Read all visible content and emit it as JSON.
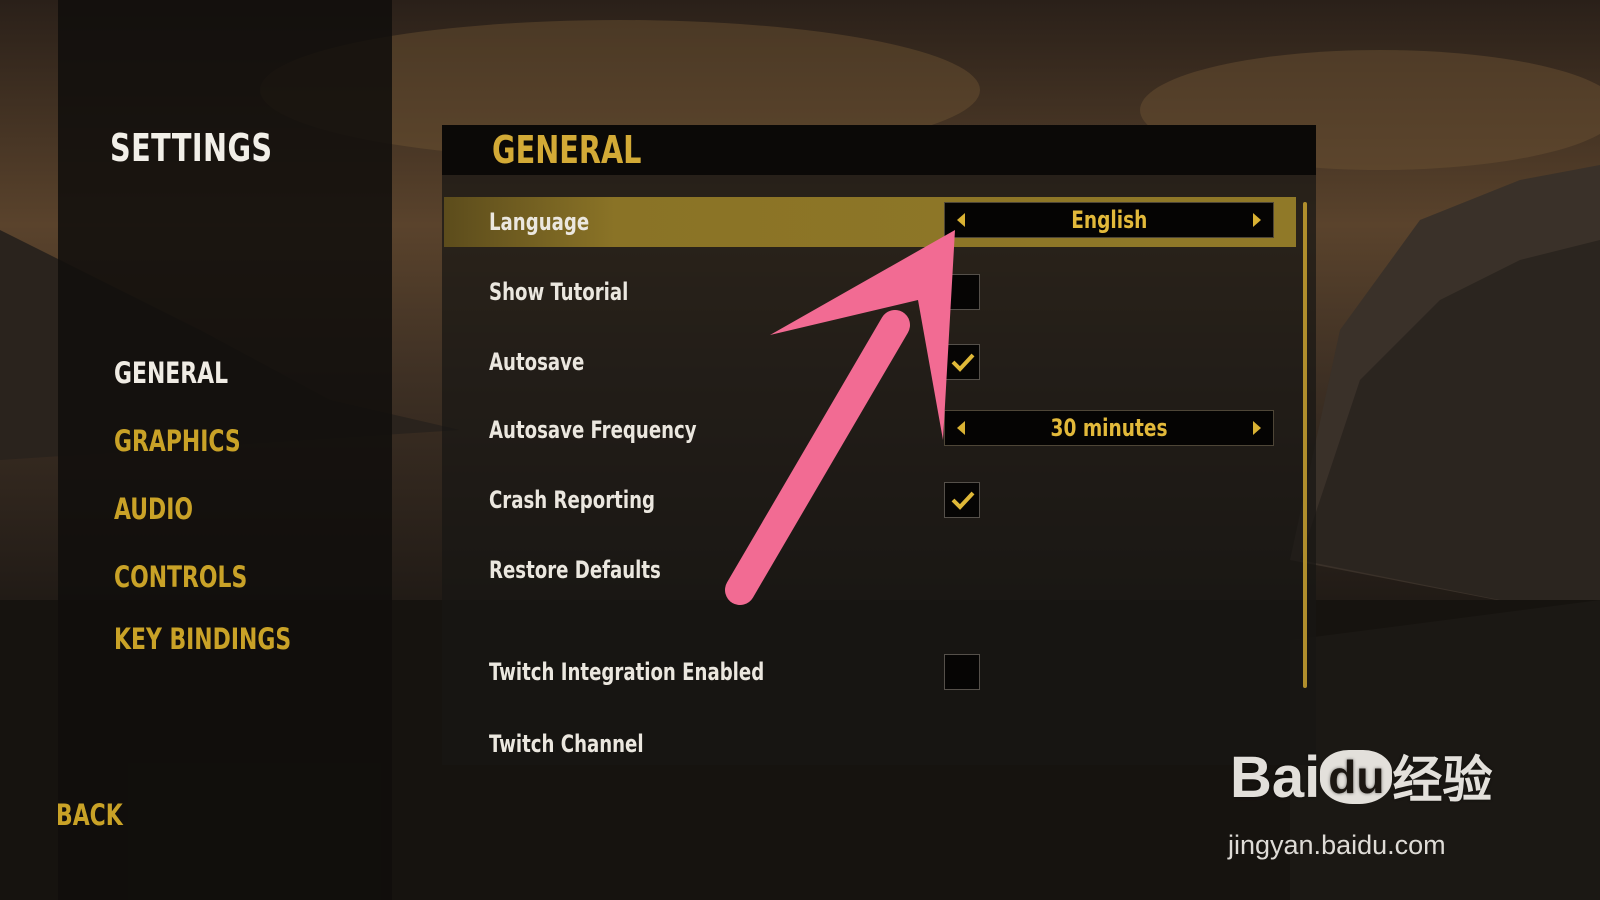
{
  "sidebar": {
    "title": "SETTINGS",
    "items": [
      {
        "label": "GENERAL",
        "active": true
      },
      {
        "label": "GRAPHICS",
        "active": false
      },
      {
        "label": "AUDIO",
        "active": false
      },
      {
        "label": "CONTROLS",
        "active": false
      },
      {
        "label": "KEY BINDINGS",
        "active": false
      }
    ],
    "back_label": "BACK"
  },
  "main": {
    "title": "GENERAL",
    "rows": {
      "language": {
        "label": "Language",
        "value": "English",
        "selected": true
      },
      "show_tutorial": {
        "label": "Show Tutorial",
        "checked": false
      },
      "autosave": {
        "label": "Autosave",
        "checked": true
      },
      "autosave_frequency": {
        "label": "Autosave Frequency",
        "value": "30 minutes"
      },
      "crash_reporting": {
        "label": "Crash Reporting",
        "checked": true
      },
      "restore_defaults": {
        "label": "Restore Defaults"
      },
      "twitch_integration": {
        "label": "Twitch Integration Enabled",
        "checked": false
      },
      "twitch_channel": {
        "label": "Twitch Channel"
      }
    }
  },
  "watermark": {
    "logo_text": "Bai",
    "logo_du": "du",
    "logo_cn": "经验",
    "url": "jingyan.baidu.com"
  },
  "colors": {
    "accent_gold": "#c9a227",
    "highlight_row": "#8a7326",
    "annotation_pink": "#f26b93"
  },
  "icons": [
    "arrow-left-icon",
    "arrow-right-icon",
    "checkmark-icon",
    "annotation-arrow-icon"
  ]
}
